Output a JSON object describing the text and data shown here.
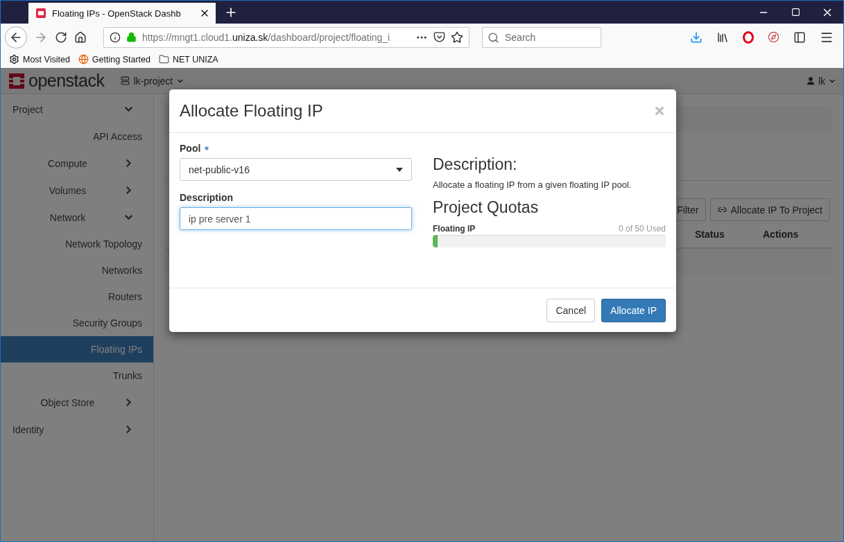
{
  "browser": {
    "tab_title": "Floating IPs - OpenStack Dashb",
    "url": {
      "prefix": "https://mngt1.cloud1.",
      "domain": "uniza.sk",
      "path": "/dashboard/project/floating_i"
    },
    "search": {
      "placeholder": "Search"
    },
    "bookmarks": [
      {
        "label": "Most Visited",
        "kind": "gear"
      },
      {
        "label": "Getting Started",
        "kind": "globe"
      },
      {
        "label": "NET UNIZA",
        "kind": "folder"
      }
    ]
  },
  "navbar": {
    "logo": "openstack",
    "project": "lk-project",
    "user": "lk"
  },
  "sidebar": {
    "items": [
      {
        "label": "Project",
        "expanded": true,
        "children": [
          {
            "label": "API Access",
            "selected": false
          },
          {
            "label": "Compute",
            "expanded": false
          },
          {
            "label": "Volumes",
            "expanded": false
          },
          {
            "label": "Network",
            "expanded": true,
            "children": [
              {
                "label": "Network Topology",
                "selected": false
              },
              {
                "label": "Networks",
                "selected": false
              },
              {
                "label": "Routers",
                "selected": false
              },
              {
                "label": "Security Groups",
                "selected": false
              },
              {
                "label": "Floating IPs",
                "selected": true
              },
              {
                "label": "Trunks",
                "selected": false
              }
            ]
          },
          {
            "label": "Object Store",
            "expanded": false
          }
        ]
      },
      {
        "label": "Identity",
        "expanded": false
      }
    ]
  },
  "content": {
    "actions": [
      "Filter",
      "Allocate IP To Project"
    ],
    "table": {
      "columns": [
        "Status",
        "Actions"
      ]
    }
  },
  "modal": {
    "title": "Allocate Floating IP",
    "fields": [
      {
        "label": "Pool",
        "required": true,
        "kind": "select",
        "value": "net-public-v16"
      },
      {
        "label": "Description",
        "required": false,
        "kind": "text",
        "value": "ip pre server 1"
      }
    ],
    "help": {
      "heading": "Description:",
      "text": "Allocate a floating IP from a given floating IP pool.",
      "quotas_heading": "Project Quotas",
      "quotas": [
        {
          "name": "Floating IP",
          "reading": "0 of 50 Used",
          "level": 0.02
        }
      ]
    },
    "buttons": [
      {
        "label": "Cancel",
        "kind": "default"
      },
      {
        "label": "Allocate IP",
        "kind": "primary"
      }
    ]
  }
}
